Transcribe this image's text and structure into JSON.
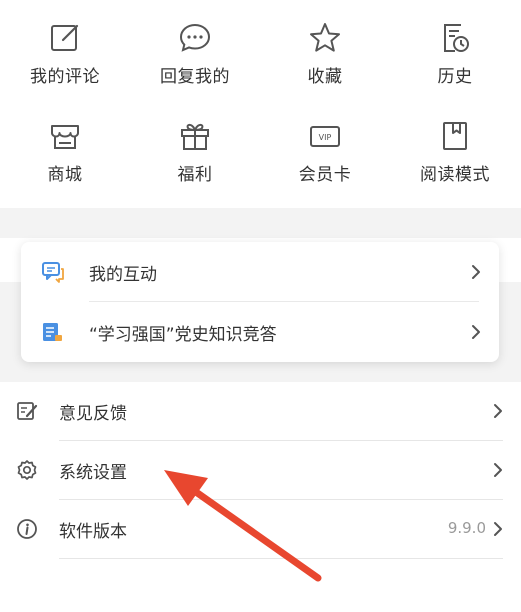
{
  "grid": {
    "items": [
      {
        "label": "我的评论",
        "icon": "edit-icon"
      },
      {
        "label": "回复我的",
        "icon": "chat-bubble-icon"
      },
      {
        "label": "收藏",
        "icon": "star-icon"
      },
      {
        "label": "历史",
        "icon": "history-icon"
      },
      {
        "label": "商城",
        "icon": "store-icon"
      },
      {
        "label": "福利",
        "icon": "gift-icon"
      },
      {
        "label": "会员卡",
        "icon": "vip-card-icon"
      },
      {
        "label": "阅读模式",
        "icon": "bookmark-icon"
      }
    ]
  },
  "card": {
    "items": [
      {
        "label": "我的互动",
        "icon": "interaction-icon"
      },
      {
        "label": "“学习强国”党史知识竞答",
        "icon": "quiz-book-icon"
      }
    ]
  },
  "list": {
    "items": [
      {
        "label": "意见反馈",
        "icon": "feedback-icon"
      },
      {
        "label": "系统设置",
        "icon": "gear-icon"
      },
      {
        "label": "软件版本",
        "icon": "info-icon",
        "value": "9.9.0"
      }
    ]
  },
  "vip_badge": "VIP",
  "colors": {
    "icon_gray": "#555555",
    "text": "#333333",
    "accent_blue": "#4a90e2",
    "annotation_arrow": "#e8472f"
  }
}
